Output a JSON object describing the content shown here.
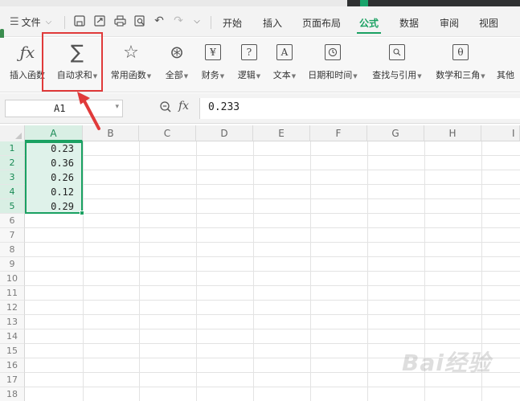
{
  "menu": {
    "file_label": "文件",
    "tabs": [
      {
        "label": "开始"
      },
      {
        "label": "插入"
      },
      {
        "label": "页面布局"
      },
      {
        "label": "公式",
        "active": true
      },
      {
        "label": "数据"
      },
      {
        "label": "审阅"
      },
      {
        "label": "视图"
      }
    ],
    "quick_icons": [
      "save-icon",
      "export-icon",
      "print-icon",
      "print-preview-icon",
      "undo-icon",
      "redo-icon",
      "more-icon"
    ]
  },
  "ribbon": {
    "insert_function": "插入函数",
    "autosum": "自动求和",
    "common_functions": "常用函数",
    "all": "全部",
    "finance": "财务",
    "logic": "逻辑",
    "text": "文本",
    "datetime": "日期和时间",
    "lookup": "查找与引用",
    "math_trig": "数学和三角",
    "other": "其他",
    "icons": {
      "finance": "¥",
      "logic": "?",
      "text": "A",
      "math_trig": "θ"
    }
  },
  "formula_bar": {
    "name_box": "A1",
    "fx_label": "fx",
    "value": "0.233"
  },
  "sheet": {
    "columns": [
      "A",
      "B",
      "C",
      "D",
      "E",
      "F",
      "G",
      "H",
      "I"
    ],
    "rows": [
      "1",
      "2",
      "3",
      "4",
      "5",
      "6",
      "7",
      "8",
      "9",
      "10",
      "11",
      "12",
      "13",
      "14",
      "15",
      "16",
      "17",
      "18"
    ],
    "column_a_values": [
      "0.23",
      "0.36",
      "0.26",
      "0.12",
      "0.29"
    ],
    "selection": "A1:A5"
  },
  "watermark": "Bai经验",
  "colors": {
    "accent": "#1aa162",
    "highlight": "#e03a3a"
  }
}
